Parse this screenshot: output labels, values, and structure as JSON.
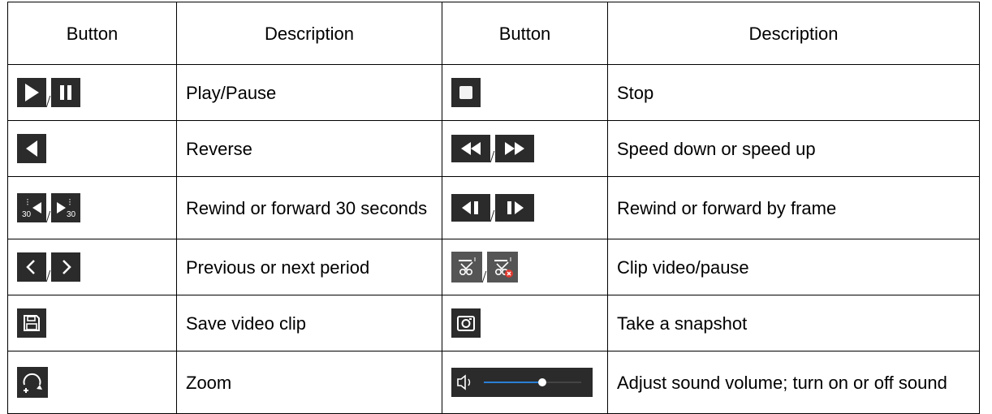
{
  "header": {
    "button_col": "Button",
    "description_col": "Description"
  },
  "rows": [
    {
      "left_icons": [
        "play-icon",
        "pause-icon"
      ],
      "left_desc": "Play/Pause",
      "right_icons": [
        "stop-icon"
      ],
      "right_desc": "Stop"
    },
    {
      "left_icons": [
        "reverse-icon"
      ],
      "left_desc": "Reverse",
      "right_icons": [
        "speed-down-icon",
        "speed-up-icon"
      ],
      "right_desc": "Speed down or speed up"
    },
    {
      "left_icons": [
        "rewind-30-icon",
        "forward-30-icon"
      ],
      "left_desc": "Rewind or forward 30 seconds",
      "right_icons": [
        "frame-back-icon",
        "frame-forward-icon"
      ],
      "right_desc": "Rewind or forward by frame"
    },
    {
      "left_icons": [
        "previous-period-icon",
        "next-period-icon"
      ],
      "left_desc": "Previous or next period",
      "right_icons": [
        "clip-icon",
        "clip-pause-icon"
      ],
      "right_desc": "Clip video/pause"
    },
    {
      "left_icons": [
        "save-icon"
      ],
      "left_desc": "Save video clip",
      "right_icons": [
        "camera-icon"
      ],
      "right_desc": "Take a snapshot"
    },
    {
      "left_icons": [
        "zoom-icon"
      ],
      "left_desc": "Zoom",
      "right_icons": [
        "volume-slider-icon"
      ],
      "right_desc": "Adjust sound volume; turn on or off sound"
    }
  ],
  "icon_labels": {
    "rewind_30_text": "30",
    "forward_30_text": "30"
  },
  "colors": {
    "icon_bg": "#2b2b2b",
    "icon_fg": "#ffffff",
    "clip_badge": "#e03a2f",
    "volume_track": "#2a7fd4"
  },
  "volume_level": 0.6
}
